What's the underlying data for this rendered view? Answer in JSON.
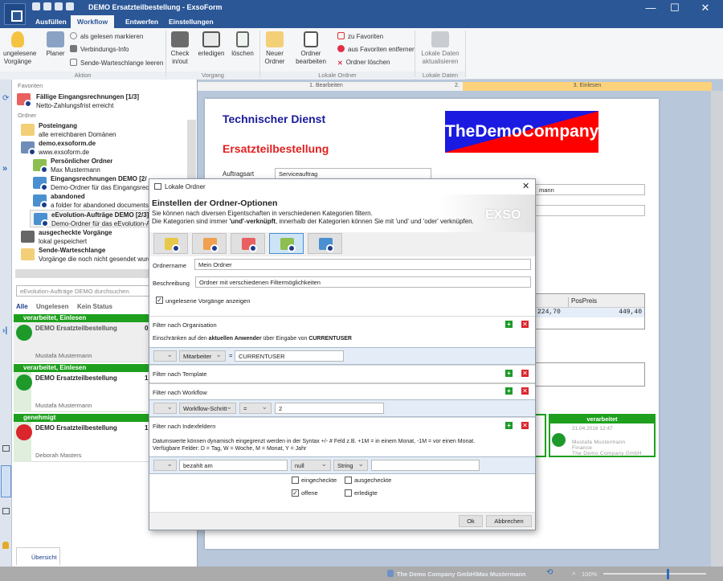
{
  "window": {
    "title": "DEMO Ersatzteilbestellung - ExsoForm",
    "minimize": "—",
    "maximize": "☐",
    "close": "✕"
  },
  "tabs": [
    "Ausfüllen",
    "Workflow",
    "Entwerfen",
    "Einstellungen"
  ],
  "ribbon": {
    "aktion": {
      "label": "Aktion",
      "unread": "ungelesene Vorgänge",
      "planer": "Planer",
      "mark_read": "als gelesen markieren",
      "conn_info": "Verbindungs-Info",
      "clear_queue": "Sende-Warteschlange leeren"
    },
    "vorgang": {
      "label": "Vorgang",
      "checkinout": "Check in/out",
      "erledigen": "erledigen",
      "loeschen": "löschen"
    },
    "lokale_ordner": {
      "label": "Lokale Ordner",
      "neuer": "Neuer Ordner",
      "bearbeiten": "Ordner bearbeiten",
      "zu_fav": "zu Favoriten",
      "aus_fav": "aus Favoriten entfernen",
      "ordner_loeschen": "Ordner löschen"
    },
    "lokale_daten": {
      "label": "Lokale Daten",
      "aktualisieren": "Lokale Daten aktualisieren"
    }
  },
  "left": {
    "favoriten_label": "Favoriten",
    "favorite": {
      "title": "Fällige Eingangsrechnungen [1/3]",
      "sub": "Netto-Zahlungsfrist erreicht"
    },
    "ordner_label": "Ordner",
    "tree": [
      {
        "title": "Posteingang",
        "sub": "alle erreichbaren Domänen"
      },
      {
        "title": "demo.exsoform.de",
        "sub": "www.exsoform.de"
      },
      {
        "title": "Persönlicher Ordner",
        "sub": "Max Mustermann"
      },
      {
        "title": "Eingangsrechnungen DEMO [2/",
        "sub": "Demo-Ordner für das Eingangsrech"
      },
      {
        "title": "abandoned",
        "sub": "a folder for abandoned documents"
      },
      {
        "title": "eEvolution-Aufträge DEMO [2/3]",
        "sub": "Demo-Ordner für das eEvolution-Au"
      },
      {
        "title": "ausgecheckte Vorgänge",
        "sub": "lokal gespeichert"
      },
      {
        "title": "Sende-Warteschlange",
        "sub": "Vorgänge die noch nicht gesendet wurd"
      }
    ],
    "search_placeholder": "eEvolution-Aufträge DEMO durchsuchen.",
    "filters": [
      "Alle",
      "Ungelesen",
      "Kein Status"
    ],
    "cards": [
      {
        "status": "verarbeitet, Einlesen",
        "title": "DEMO Ersatzteilbestellung",
        "num": "0",
        "user": "Mustafa Mustermann",
        "color": "#1e9a2a"
      },
      {
        "status": "verarbeitet, Einlesen",
        "title": "DEMO Ersatzteilbestellung",
        "num": "1",
        "user": "Mustafa Mustermann",
        "color": "#1e9a2a"
      },
      {
        "status": "genehmigt",
        "title": "DEMO Ersatzteilbestellung",
        "num": "1",
        "user": "Deborah Masters",
        "color": "#d9252b"
      }
    ],
    "overview_tab": "Übersicht"
  },
  "steps": [
    "1. Bearbeiten",
    "2.",
    "3. Einlesen"
  ],
  "doc": {
    "heading1": "Technischer Dienst",
    "heading2": "Ersatzteilbestellung",
    "logo": "TheDemoCompany",
    "auftragsart_label": "Auftragsart",
    "auftragsart_value": "Serviceauftrag",
    "person_value": "mann",
    "col_pospreis": "PosPreis",
    "cell1": "224,70",
    "cell2": "449,40",
    "stamp": {
      "status": "verarbeitet",
      "date": "21.04.2016 12:47",
      "name": "Mustafa Mustermann",
      "dept": "Finance",
      "company": "The Demo Company GmbH"
    }
  },
  "dialog": {
    "title": "Lokale Ordner",
    "heading": "Einstellen der Ordner-Optionen",
    "desc1": "Sie können nach diversen Eigentschaften in verschiedenen Kategorien filtern.",
    "desc2_a": "Die Kategorien sind immer ",
    "desc2_b": "'und'-verknüpft",
    "desc2_c": ", innerhalb der Kategorien können Sie mit 'und' und 'oder' verknüpfen.",
    "watermark": "EXSO",
    "folder_colors": [
      "#e8c84a",
      "#f0a050",
      "#e86060",
      "#8cbf50",
      "#4a90d0"
    ],
    "selected_color": 3,
    "ordnername_label": "Ordnername",
    "ordnername_value": "Mein Ordner",
    "beschreibung_label": "Beschreibung",
    "beschreibung_value": "Ordner mit verschiedenen Filtermöglichkeiten",
    "unread_check": "ungelesene Vorgänge anzeigen",
    "org": {
      "label": "Filter nach Organisation",
      "hint_a": "Einschränken auf den ",
      "hint_b": "aktuellen Anwender",
      "hint_c": " über Eingabe von ",
      "hint_d": "CURRENTUSER",
      "field": "Mitarbeiter",
      "op": "=",
      "value": "CURRENTUSER"
    },
    "template": {
      "label": "Filter nach Template"
    },
    "workflow": {
      "label": "Filter nach Workflow",
      "field": "Workflow-Schritt",
      "op": "=",
      "value": "2"
    },
    "index": {
      "label": "Filter nach Indexfeldern",
      "hint1": "Datumswerte können dynamisch eingegrenzt werden in der Syntax +/- # Feld z.B. +1M = in einem Monat, -1M = vor einen Monat.",
      "hint2": "Verfügbare Felder: D = Tag, W = Woche, M = Monat, Y = Jahr",
      "field": "bezahlt am",
      "op": "null",
      "type": "String",
      "value": ""
    },
    "checks": [
      {
        "label": "eingecheckte",
        "checked": false
      },
      {
        "label": "ausgecheckte",
        "checked": false
      },
      {
        "label": "offene",
        "checked": true
      },
      {
        "label": "erledigte",
        "checked": false
      }
    ],
    "ok": "Ok",
    "cancel": "Abbrechen"
  },
  "status": {
    "user": "The Demo Company GmbH\\Max Mustermann",
    "zoom": "100%",
    "zoom_level": 0.62
  }
}
